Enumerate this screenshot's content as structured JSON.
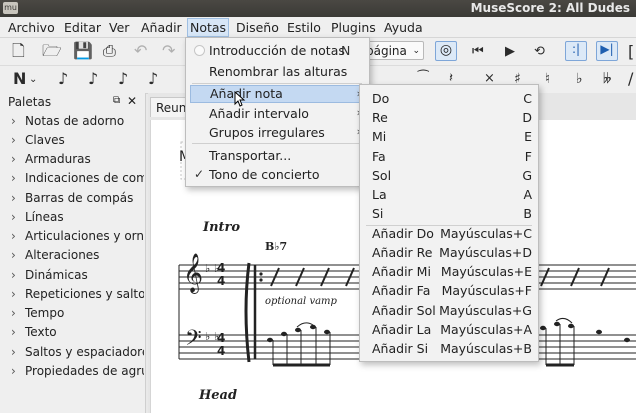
{
  "window": {
    "title": "MuseScore 2: All Dudes",
    "app_icon": "mu"
  },
  "menubar": [
    {
      "label": "Archivo"
    },
    {
      "label": "Editar"
    },
    {
      "label": "Ver"
    },
    {
      "label": "Añadir"
    },
    {
      "label": "Notas"
    },
    {
      "label": "Diseño"
    },
    {
      "label": "Estilo"
    },
    {
      "label": "Plugins"
    },
    {
      "label": "Ayuda"
    }
  ],
  "toolbar": {
    "zoom_combo": "página"
  },
  "palette": {
    "title": "Paletas",
    "items": [
      "Notas de adorno",
      "Claves",
      "Armaduras",
      "Indicaciones de comp",
      "Barras de compás",
      "Líneas",
      "Articulaciones y orna",
      "Alteraciones",
      "Dinámicas",
      "Repeticiones y saltos",
      "Tempo",
      "Texto",
      "Saltos y espaciadores",
      "Propiedades de agrup"
    ]
  },
  "score": {
    "tab_label": "Reun",
    "title_initial": "M",
    "section_intro": "Intro",
    "chord": "B♭7",
    "annotation": "optional vamp",
    "section_head": "Head",
    "key_flats": "♭ ♭",
    "time_sig": [
      "4",
      "4"
    ]
  },
  "notes_menu": {
    "items": [
      {
        "label": "Introducción de notas",
        "shortcut": "N"
      },
      {
        "label": "Renombrar las alturas"
      },
      {
        "label": "Añadir nota"
      },
      {
        "label": "Añadir intervalo"
      },
      {
        "label": "Grupos irregulares"
      },
      {
        "label": "Transportar..."
      },
      {
        "label": "Tono de concierto"
      }
    ]
  },
  "add_note_submenu": {
    "items": [
      {
        "label": "Do",
        "shortcut": "C"
      },
      {
        "label": "Re",
        "shortcut": "D"
      },
      {
        "label": "Mi",
        "shortcut": "E"
      },
      {
        "label": "Fa",
        "shortcut": "F"
      },
      {
        "label": "Sol",
        "shortcut": "G"
      },
      {
        "label": "La",
        "shortcut": "A"
      },
      {
        "label": "Si",
        "shortcut": "B"
      },
      {
        "label": "Añadir Do",
        "shortcut": "Mayúsculas+C"
      },
      {
        "label": "Añadir Re",
        "shortcut": "Mayúsculas+D"
      },
      {
        "label": "Añadir Mi",
        "shortcut": "Mayúsculas+E"
      },
      {
        "label": "Añadir Fa",
        "shortcut": "Mayúsculas+F"
      },
      {
        "label": "Añadir Sol",
        "shortcut": "Mayúsculas+G"
      },
      {
        "label": "Añadir La",
        "shortcut": "Mayúsculas+A"
      },
      {
        "label": "Añadir Si",
        "shortcut": "Mayúsculas+B"
      }
    ]
  },
  "colors": {
    "highlight": "#c4d9f2",
    "titlebar": "#3d3c38"
  }
}
